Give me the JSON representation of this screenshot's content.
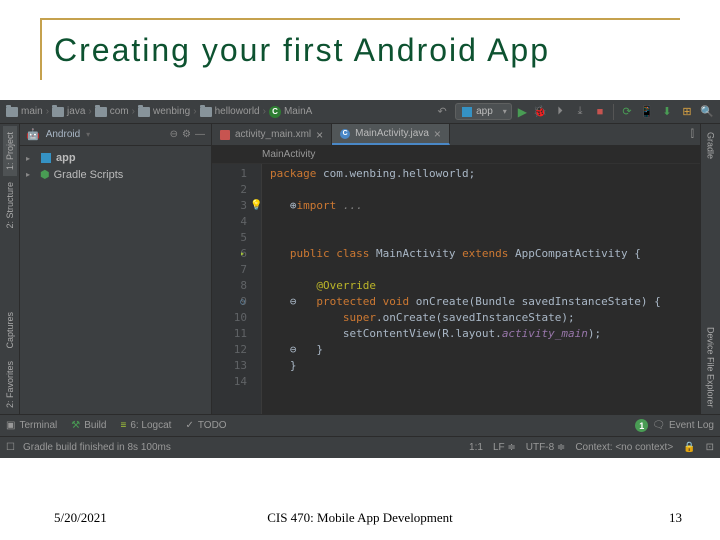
{
  "slide": {
    "title": "Creating  your  first  Android  App",
    "date": "5/20/2021",
    "course": "CIS 470: Mobile App Development",
    "page": "13"
  },
  "breadcrumb": [
    "main",
    "java",
    "com",
    "wenbing",
    "helloworld",
    "MainA"
  ],
  "config": "app",
  "leftTabs": [
    "1: Project",
    "2: Structure",
    "Captures",
    "2: Favorites"
  ],
  "rightTabs": [
    "Gradle",
    "Device File Explorer"
  ],
  "projectPanel": {
    "title": "Android",
    "items": [
      {
        "label": "app",
        "type": "module"
      },
      {
        "label": "Gradle Scripts",
        "type": "gradle"
      }
    ]
  },
  "editorTabs": [
    {
      "label": "activity_main.xml",
      "type": "xml",
      "active": false
    },
    {
      "label": "MainActivity.java",
      "type": "java",
      "active": true
    }
  ],
  "packagePath": "com.wenbing.helloworld",
  "code": {
    "lines": [
      "1",
      "2",
      "3",
      "4",
      "5",
      "6",
      "7",
      "8",
      "9",
      "10",
      "11",
      "12",
      "13",
      "14"
    ],
    "l1_kw": "package ",
    "l1_pkg": "com.wenbing.helloworld;",
    "l3_kw": "import ",
    "l3_rest": "...",
    "l6_kw": "public class ",
    "l6_name": "MainActivity ",
    "l6_ext": "extends ",
    "l6_parent": "AppCompatActivity {",
    "l8_ann": "@Override",
    "l9_kw": "protected void ",
    "l9_name": "onCreate(Bundle savedInstanceState) {",
    "l10_super": "super",
    "l10_rest": ".onCreate(savedInstanceState);",
    "l11_fn": "setContentView(R.layout.",
    "l11_field": "activity_main",
    "l11_end": ");",
    "l12": "}",
    "l13": "}"
  },
  "bottomTabs": {
    "terminal": "Terminal",
    "build": "Build",
    "logcat": "6: Logcat",
    "todo": "TODO",
    "eventlog": "Event Log",
    "badge": "1"
  },
  "status": {
    "msg": "Gradle build finished in 8s 100ms",
    "pos": "1:1",
    "le": "LF",
    "enc": "UTF-8",
    "ctx": "Context: <no context>"
  }
}
